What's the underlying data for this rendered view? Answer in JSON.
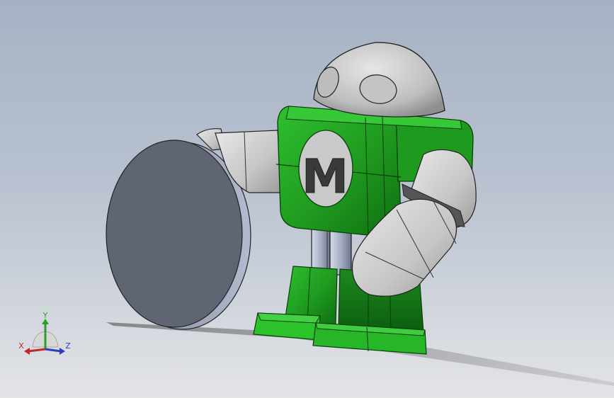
{
  "viewport": {
    "background_top": "#a6b2c4",
    "background_bottom": "#e3e4e6"
  },
  "model": {
    "chest_logo_letter": "M",
    "body_color": "#1f9a1f",
    "body_dark": "#0f6e12",
    "part_gray": "#c8c8c8",
    "disc_face_color": "#5f6573",
    "disc_rim_color": "#a2a8bd",
    "rod_color": "#a6aec4"
  },
  "triad": {
    "x_label": "X",
    "y_label": "Y",
    "z_label": "Z",
    "x_color": "#c0282a",
    "y_color": "#2aa02a",
    "z_color": "#2a3fc0"
  }
}
